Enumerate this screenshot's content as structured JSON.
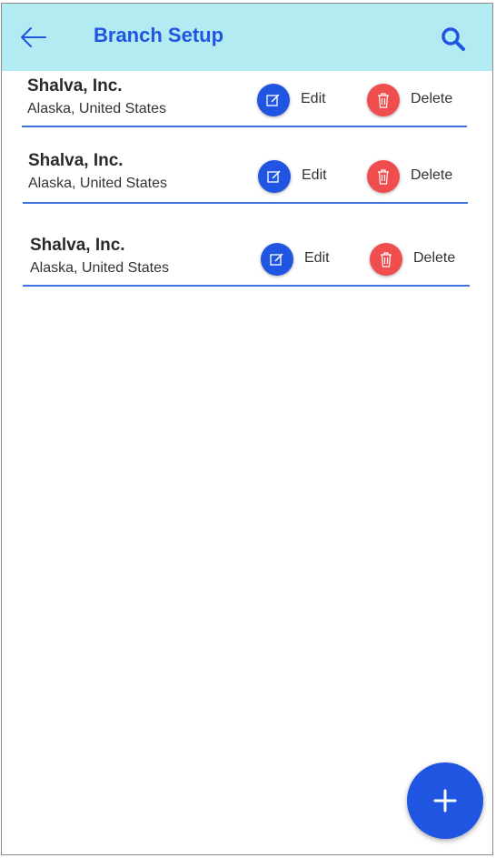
{
  "header": {
    "title": "Branch Setup",
    "back_icon": "arrow-left-icon",
    "search_icon": "search-icon"
  },
  "branches": [
    {
      "name": "Shalva, Inc.",
      "location": "Alaska, United States",
      "edit_label": "Edit",
      "delete_label": "Delete"
    },
    {
      "name": "Shalva, Inc.",
      "location": "Alaska, United States",
      "edit_label": "Edit",
      "delete_label": "Delete"
    },
    {
      "name": "Shalva, Inc.",
      "location": "Alaska, United States",
      "edit_label": "Edit",
      "delete_label": "Delete"
    }
  ],
  "fab": {
    "icon": "plus-icon"
  },
  "colors": {
    "header_bg": "#b3ebf2",
    "accent": "#1f55e0",
    "danger": "#f04e4e",
    "divider": "#3d72e0"
  }
}
